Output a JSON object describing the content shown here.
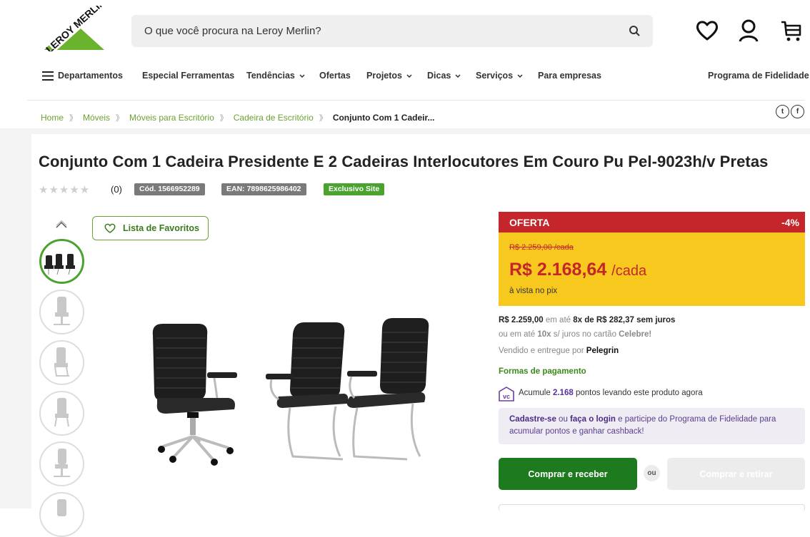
{
  "header": {
    "logo_text": "LEROY MERLIN",
    "search_placeholder": "O que você procura na Leroy Merlin?",
    "icons": [
      "heart-icon",
      "user-icon",
      "cart-icon"
    ]
  },
  "nav": {
    "departments": "Departamentos",
    "items": [
      {
        "label": "Especial Ferramentas"
      },
      {
        "label": "Tendências"
      },
      {
        "label": "Ofertas"
      },
      {
        "label": "Projetos"
      },
      {
        "label": "Dicas"
      },
      {
        "label": "Serviços"
      },
      {
        "label": "Para empresas"
      }
    ],
    "loyalty": "Programa de Fidelidade"
  },
  "breadcrumb": [
    "Home",
    "Móveis",
    "Móveis para Escritório",
    "Cadeira de Escritório",
    "Conjunto Com 1 Cadeir..."
  ],
  "social": [
    "twitter-icon",
    "facebook-icon"
  ],
  "product": {
    "title": "Conjunto Com 1 Cadeira Presidente E 2 Cadeiras Interlocutores Em Couro Pu Pel-9023h/v Pretas",
    "stars": "★★★★★",
    "reviews": "(0)",
    "code": "Cód. 1566952289",
    "ean": "EAN: 7898625986402",
    "exclusive": "Exclusivo Site",
    "fav_label": "Lista de Favoritos"
  },
  "price": {
    "offer_label": "OFERTA",
    "discount": "-4%",
    "old_price": "R$ 2.259,00 /cada",
    "new_price": "R$ 2.168,64",
    "unit": "/cada",
    "pix": "à vista no pix",
    "installment_full": "R$ 2.259,00",
    "installment_em": "em até",
    "installment_text": "8x de R$ 282,37 sem juros",
    "card_pre": "ou em até",
    "card_times": "10x",
    "card_mid": "s/ juros no cartão",
    "card_name": "Celebre!",
    "seller_pre": "Vendido e entregue por",
    "seller": "Pelegrin",
    "payments": "Formas de pagamento",
    "points_pre": "Acumule",
    "points": "2.168",
    "points_post": "pontos levando este produto agora",
    "loyalty_register": "Cadastre-se",
    "loyalty_or": "ou",
    "loyalty_login": "faça o login",
    "loyalty_text": "e participe do Programa de Fidelidade para acumular pontos e ganhar cashback!",
    "buy": "Comprar e receber",
    "or": "ou",
    "pickup": "Comprar e retirar"
  },
  "colors": {
    "brand_green": "#4aa32f",
    "offer_red": "#c4262b",
    "price_yellow": "#f7c91f",
    "buy_green": "#1e7a1f"
  }
}
